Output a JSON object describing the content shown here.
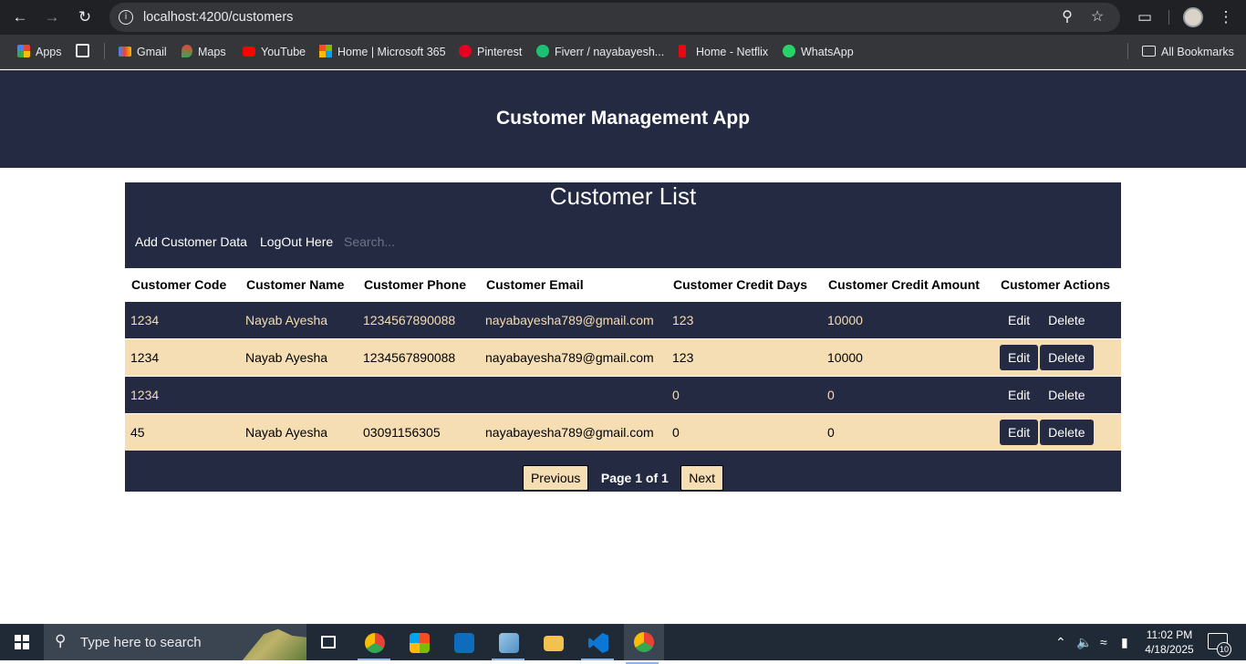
{
  "browser": {
    "url": "localhost:4200/customers",
    "bookmarks": [
      {
        "label": "Apps",
        "icon": "apps-grid-icon"
      },
      {
        "label": "Gmail",
        "icon": "gmail-icon"
      },
      {
        "label": "Maps",
        "icon": "maps-icon"
      },
      {
        "label": "YouTube",
        "icon": "youtube-icon"
      },
      {
        "label": "Home | Microsoft 365",
        "icon": "microsoft-icon"
      },
      {
        "label": "Pinterest",
        "icon": "pinterest-icon"
      },
      {
        "label": "Fiverr / nayabayesh...",
        "icon": "fiverr-icon"
      },
      {
        "label": "Home - Netflix",
        "icon": "netflix-icon"
      },
      {
        "label": "WhatsApp",
        "icon": "whatsapp-icon"
      },
      {
        "label": "All Bookmarks",
        "icon": "folder-icon"
      }
    ]
  },
  "app": {
    "title": "Customer Management App",
    "list_title": "Customer List",
    "add_label": "Add Customer Data",
    "logout_label": "LogOut Here",
    "search_placeholder": "Search..."
  },
  "table": {
    "headers": [
      "Customer Code",
      "Customer Name",
      "Customer Phone",
      "Customer Email",
      "Customer Credit Days",
      "Customer Credit Amount",
      "Customer Actions"
    ],
    "rows": [
      {
        "code": "1234",
        "name": "Nayab Ayesha",
        "phone": "1234567890088",
        "email": "nayabayesha789@gmail.com",
        "credit_days": "123",
        "credit_amount": "10000",
        "edit": "Edit",
        "delete": "Delete"
      },
      {
        "code": "1234",
        "name": "Nayab Ayesha",
        "phone": "1234567890088",
        "email": "nayabayesha789@gmail.com",
        "credit_days": "123",
        "credit_amount": "10000",
        "edit": "Edit",
        "delete": "Delete"
      },
      {
        "code": "1234",
        "name": "",
        "phone": "",
        "email": "",
        "credit_days": "0",
        "credit_amount": "0",
        "edit": "Edit",
        "delete": "Delete"
      },
      {
        "code": "45",
        "name": "Nayab Ayesha",
        "phone": "03091156305",
        "email": "nayabayesha789@gmail.com",
        "credit_days": "0",
        "credit_amount": "0",
        "edit": "Edit",
        "delete": "Delete"
      }
    ]
  },
  "pagination": {
    "previous": "Previous",
    "info": "Page 1 of 1",
    "next": "Next"
  },
  "taskbar": {
    "search_placeholder": "Type here to search",
    "time": "11:02 PM",
    "date": "4/18/2025",
    "notification_count": "10"
  },
  "colors": {
    "navy": "#242a42",
    "wheat": "#f5deb3",
    "white": "#ffffff"
  }
}
